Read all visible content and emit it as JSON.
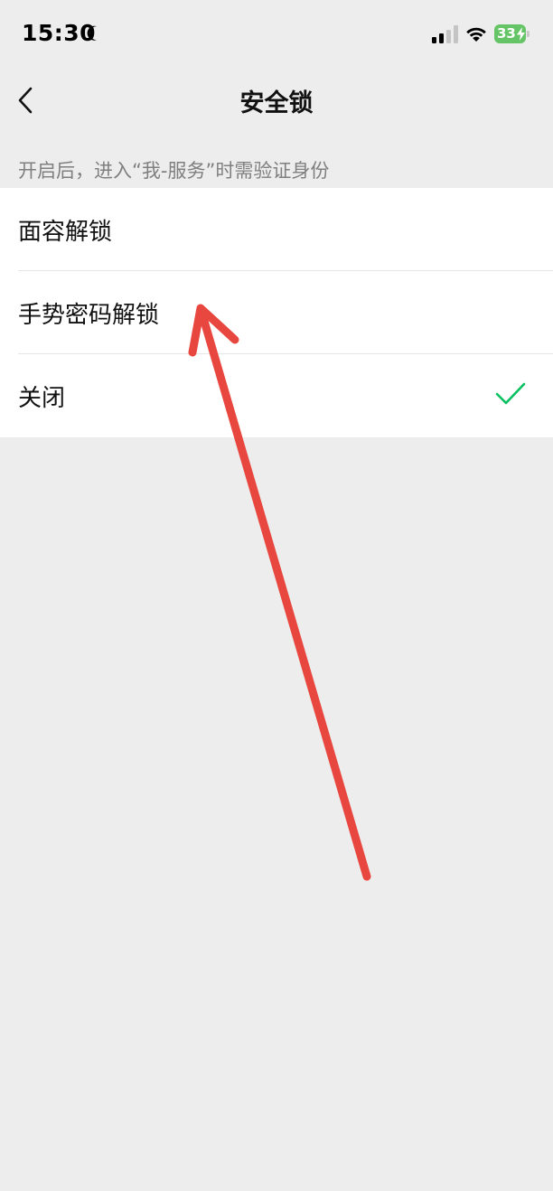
{
  "status_bar": {
    "time": "15:30",
    "battery_level": "33",
    "battery_color": "#65c466"
  },
  "nav": {
    "title": "安全锁",
    "back_icon": "chevron-left-icon"
  },
  "section": {
    "hint": "开启后，进入“我-服务”时需验证身份"
  },
  "options": [
    {
      "label": "面容解锁",
      "selected": false
    },
    {
      "label": "手势密码解锁",
      "selected": false
    },
    {
      "label": "关闭",
      "selected": true
    }
  ],
  "colors": {
    "background": "#ededed",
    "list_background": "#ffffff",
    "check": "#07c160",
    "annotation_arrow": "#e8473f"
  },
  "icons": [
    "moon-icon",
    "cellular-signal-icon",
    "wifi-icon",
    "battery-charging-icon",
    "chevron-left-icon",
    "checkmark-icon",
    "annotation-arrow"
  ]
}
